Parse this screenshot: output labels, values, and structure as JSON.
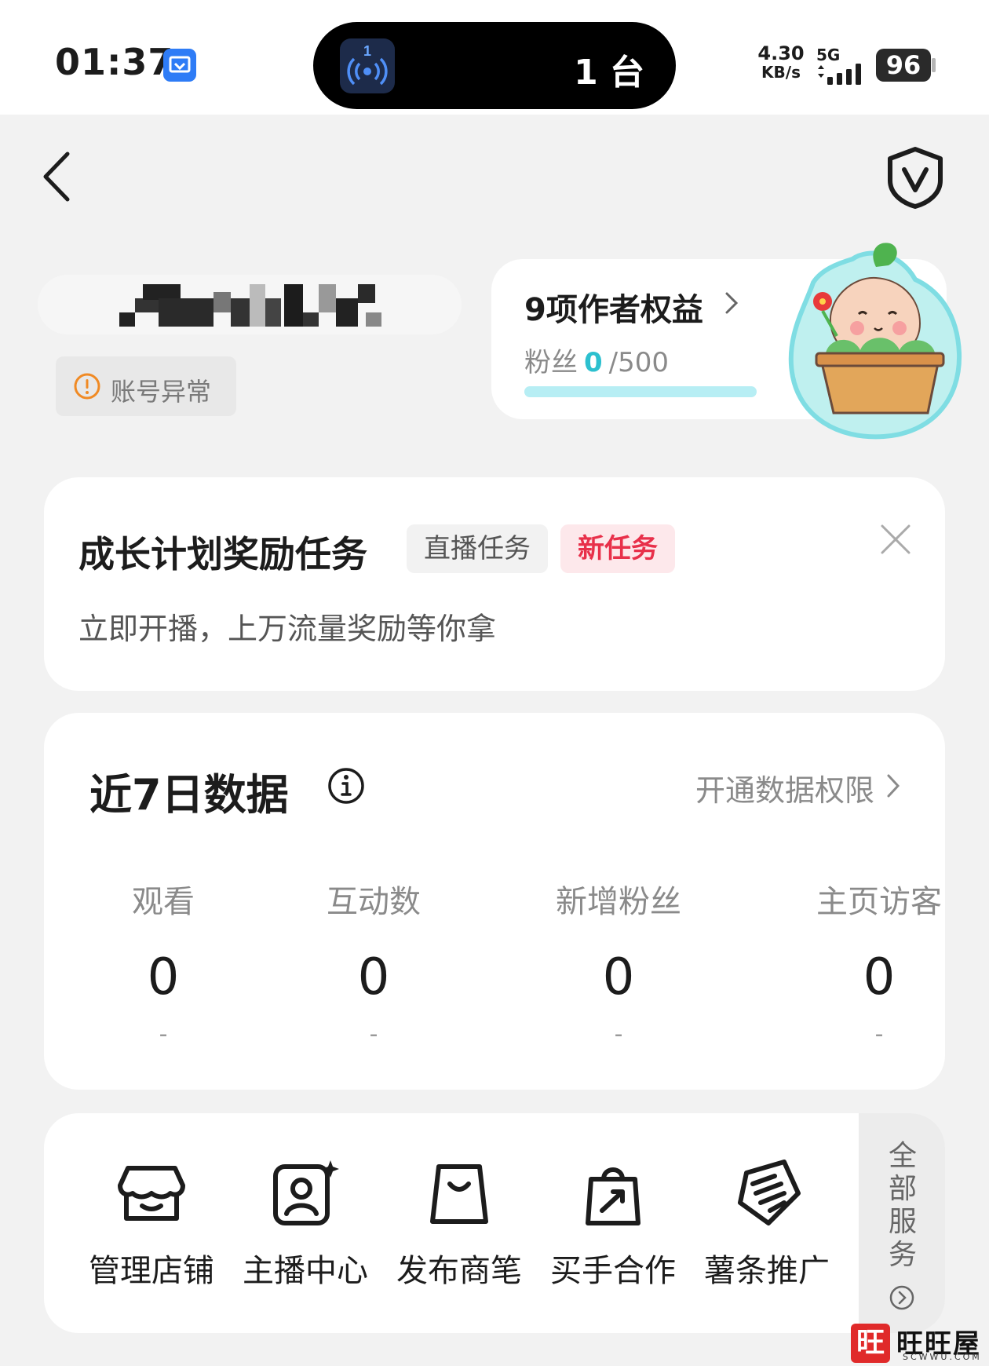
{
  "status_bar": {
    "time": "01:37",
    "island_badge": "1",
    "island_count": "1 台",
    "net_speed": "4.30",
    "net_speed_unit": "KB/s",
    "network": "5G",
    "battery": "96"
  },
  "profile": {
    "account_warning": "账号异常"
  },
  "rights": {
    "title": "9项作者权益",
    "fans_label": "粉丝",
    "fans_count": "0",
    "fans_target": "/500",
    "progress": 0
  },
  "task": {
    "title": "成长计划奖励任务",
    "tag_live": "直播任务",
    "tag_new": "新任务",
    "subtitle": "立即开播，上万流量奖励等你拿"
  },
  "data": {
    "title": "近7日数据",
    "link": "开通数据权限",
    "metrics": [
      {
        "label": "观看",
        "value": "0",
        "delta": "-"
      },
      {
        "label": "互动数",
        "value": "0",
        "delta": "-"
      },
      {
        "label": "新增粉丝",
        "value": "0",
        "delta": "-"
      },
      {
        "label": "主页访客",
        "value": "0",
        "delta": "-"
      }
    ]
  },
  "services": {
    "items": [
      {
        "label": "管理店铺",
        "icon": "shop-icon"
      },
      {
        "label": "主播中心",
        "icon": "anchor-profile-icon"
      },
      {
        "label": "发布商笔",
        "icon": "shopping-bag-icon"
      },
      {
        "label": "买手合作",
        "icon": "buyer-bag-icon"
      },
      {
        "label": "薯条推广",
        "icon": "fries-promo-icon"
      }
    ],
    "all_label": "全部服务"
  },
  "watermark": {
    "logo_char": "旺",
    "text": "旺旺屋",
    "sub": "SCWWU.COM"
  },
  "colors": {
    "accent_cyan": "#2cc0cf",
    "new_tag_red": "#e8304a",
    "warning_orange": "#f08a24"
  }
}
